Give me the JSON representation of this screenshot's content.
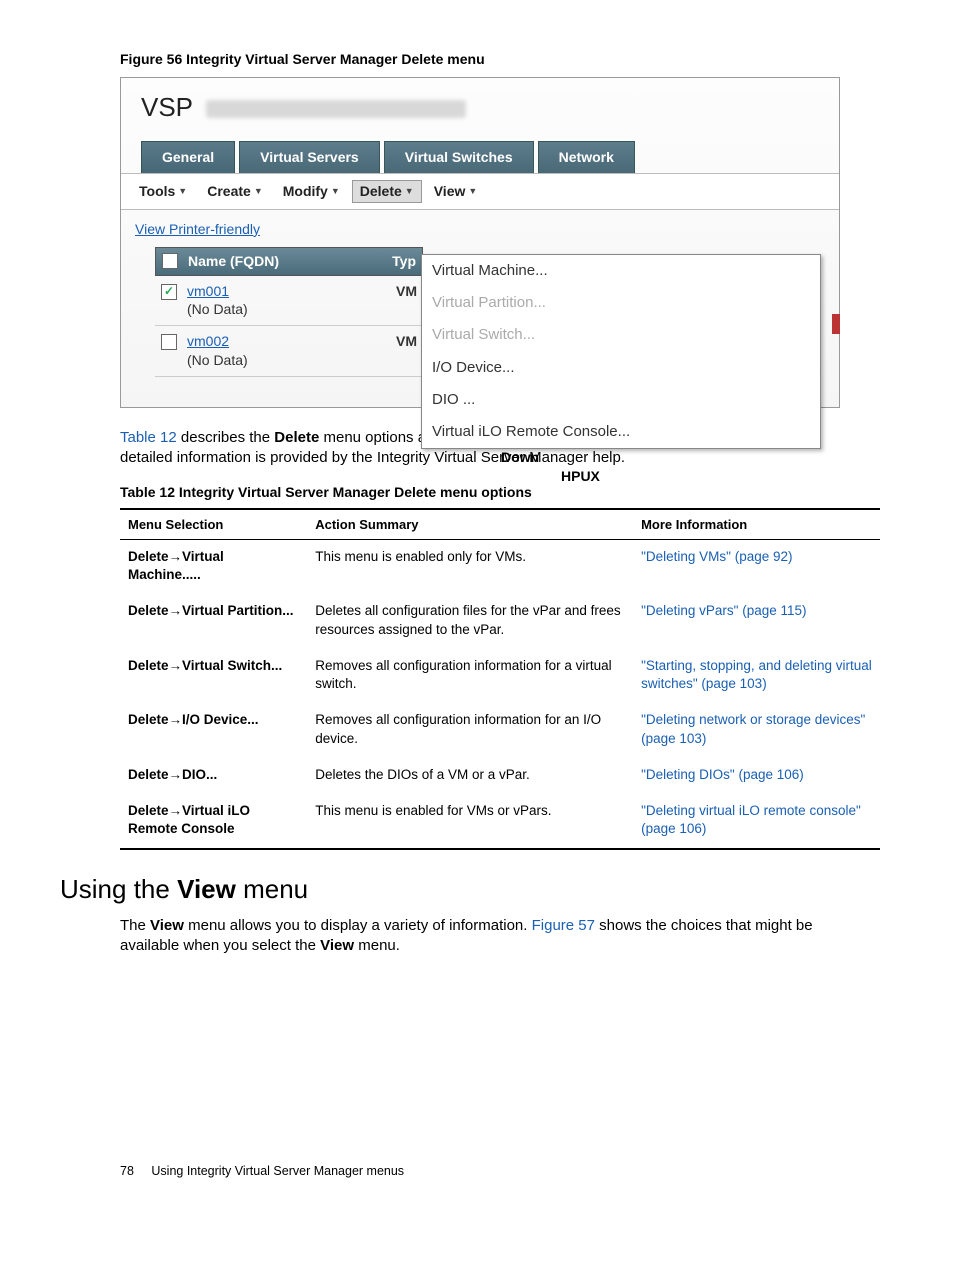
{
  "figure_caption": "Figure 56 Integrity Virtual Server Manager Delete menu",
  "screenshot": {
    "title": "VSP",
    "tabs": [
      "General",
      "Virtual Servers",
      "Virtual Switches",
      "Network"
    ],
    "menus": [
      "Tools",
      "Create",
      "Modify",
      "Delete",
      "View"
    ],
    "printer_link": "View Printer-friendly",
    "th_name": "Name (FQDN)",
    "th_type": "Typ",
    "rows": [
      {
        "name": "vm001",
        "sub": "(No Data)",
        "type": "VM",
        "checked": true
      },
      {
        "name": "vm002",
        "sub": "(No Data)",
        "type": "VM",
        "checked": false
      }
    ],
    "dropdown": [
      {
        "label": "Virtual Machine...",
        "disabled": false
      },
      {
        "label": "Virtual Partition...",
        "disabled": true
      },
      {
        "label": "Virtual Switch...",
        "disabled": true
      },
      {
        "label": "I/O Device...",
        "disabled": false
      },
      {
        "label": "DIO ...",
        "disabled": false
      },
      {
        "label": "Virtual iLO Remote Console...",
        "disabled": false
      }
    ],
    "extra_down": "Down",
    "extra_hpux": "HPUX"
  },
  "para1_pre": " describes the ",
  "para1_table_ref": "Table 12",
  "para1_bold": "Delete",
  "para1_post": " menu options and where to obtain more information in this manual. More detailed information is provided by the Integrity Virtual Server Manager help.",
  "table_caption": "Table 12 Integrity Virtual Server Manager Delete menu options",
  "table_headers": [
    "Menu Selection",
    "Action Summary",
    "More Information"
  ],
  "table_rows": [
    {
      "sel": "Delete→Virtual Machine.....",
      "sum": "This menu is enabled only for VMs.",
      "info": "\"Deleting VMs\" (page 92)"
    },
    {
      "sel": "Delete→Virtual Partition...",
      "sum": "Deletes all configuration files for the vPar and frees resources assigned to the vPar.",
      "info": "\"Deleting vPars\" (page 115)"
    },
    {
      "sel": "Delete→Virtual Switch...",
      "sum": "Removes all configuration information for a virtual switch.",
      "info": "\"Starting, stopping, and deleting virtual switches\" (page 103)"
    },
    {
      "sel": "Delete→I/O Device...",
      "sum": "Removes all configuration information for an I/O device.",
      "info": "\"Deleting network or storage devices\" (page 103)"
    },
    {
      "sel": "Delete→DIO...",
      "sum": "Deletes the DIOs of a VM or a vPar.",
      "info": "\"Deleting DIOs\" (page 106)"
    },
    {
      "sel": "Delete→Virtual iLO Remote Console",
      "sum": "This menu is enabled for VMs or vPars.",
      "info": "\"Deleting virtual iLO remote console\" (page 106)"
    }
  ],
  "section_heading_pre": "Using the ",
  "section_heading_bold": "View",
  "section_heading_post": " menu",
  "view_para_pre": "The ",
  "view_para_bold": "View",
  "view_para_mid1": " menu allows you to display a variety of information. ",
  "view_para_link": "Figure 57",
  "view_para_mid2": " shows the choices that might be available when you select the ",
  "view_para_bold2": "View",
  "view_para_end": " menu.",
  "footer_page": "78",
  "footer_text": "Using Integrity Virtual Server Manager menus"
}
